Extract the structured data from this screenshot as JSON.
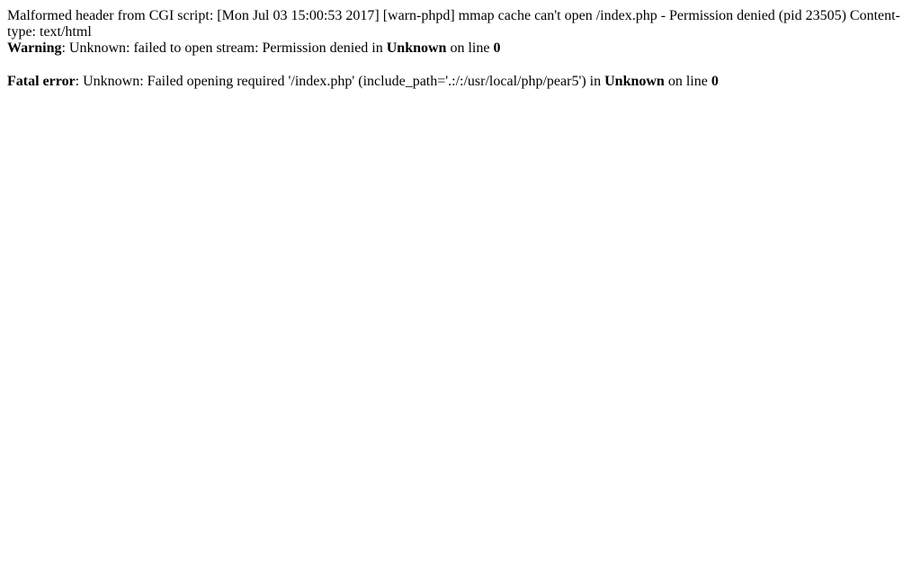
{
  "cgi_message": "Malformed header from CGI script: [Mon Jul 03 15:00:53 2017] [warn-phpd] mmap cache can't open /index.php - Permission denied (pid 23505) Content-type: text/html",
  "warning": {
    "label": "Warning",
    "message": ": Unknown: failed to open stream: Permission denied in ",
    "file": "Unknown",
    "line_text": " on line ",
    "line_number": "0"
  },
  "fatal": {
    "label": "Fatal error",
    "message": ": Unknown: Failed opening required '/index.php' (include_path='.:/:/usr/local/php/pear5') in ",
    "file": "Unknown",
    "line_text": " on line ",
    "line_number": "0"
  }
}
